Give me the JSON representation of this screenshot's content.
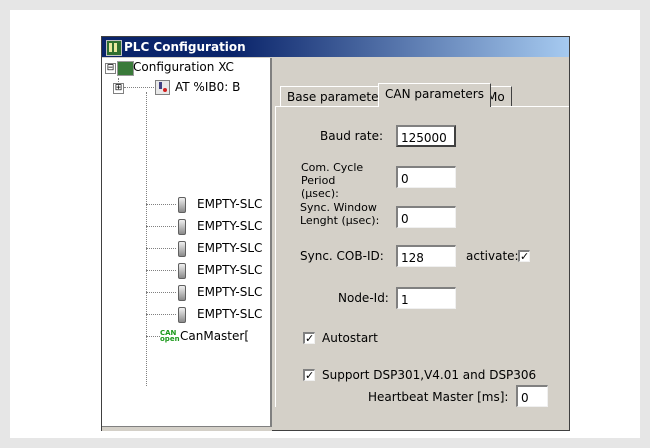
{
  "window": {
    "title": "PLC Configuration",
    "icon": "plc-config-icon"
  },
  "tree": {
    "root": {
      "label": "Configuration XC",
      "expander": "⊟"
    },
    "io_node": {
      "label": "AT %IB0: B",
      "expander": "⊞"
    },
    "slots": [
      {
        "label": "EMPTY-SLC"
      },
      {
        "label": "EMPTY-SLC"
      },
      {
        "label": "EMPTY-SLC"
      },
      {
        "label": "EMPTY-SLC"
      },
      {
        "label": "EMPTY-SLC"
      },
      {
        "label": "EMPTY-SLC"
      }
    ],
    "can_master": {
      "label": "CanMaster[",
      "icon_text": "CAN\nopen"
    }
  },
  "tabs": [
    {
      "label": "Base parameters",
      "active": false
    },
    {
      "label": "CAN parameters",
      "active": true
    },
    {
      "label": "Mo",
      "active": false
    }
  ],
  "can_params": {
    "baud_rate": {
      "label": "Baud rate:",
      "value": "125000"
    },
    "com_cycle": {
      "label": "Com. Cycle Period (µsec):",
      "value": "0"
    },
    "sync_window": {
      "label": "Sync. Window Lenght (µsec):",
      "value": "0"
    },
    "sync_cob": {
      "label": "Sync. COB-ID:",
      "value": "128",
      "activate_label": "activate:",
      "activate_checked": true
    },
    "node_id": {
      "label": "Node-Id:",
      "value": "1"
    },
    "autostart": {
      "label": "Autostart",
      "checked": true
    },
    "support_dsp": {
      "label": "Support DSP301,V4.01 and DSP306",
      "checked": true
    },
    "heartbeat": {
      "label": "Heartbeat Master [ms]:",
      "value": "0"
    }
  },
  "colors": {
    "titlebar": "#0a246a",
    "dialog_bg": "#d4d0c8",
    "page_bg": "#e6e6e6"
  }
}
